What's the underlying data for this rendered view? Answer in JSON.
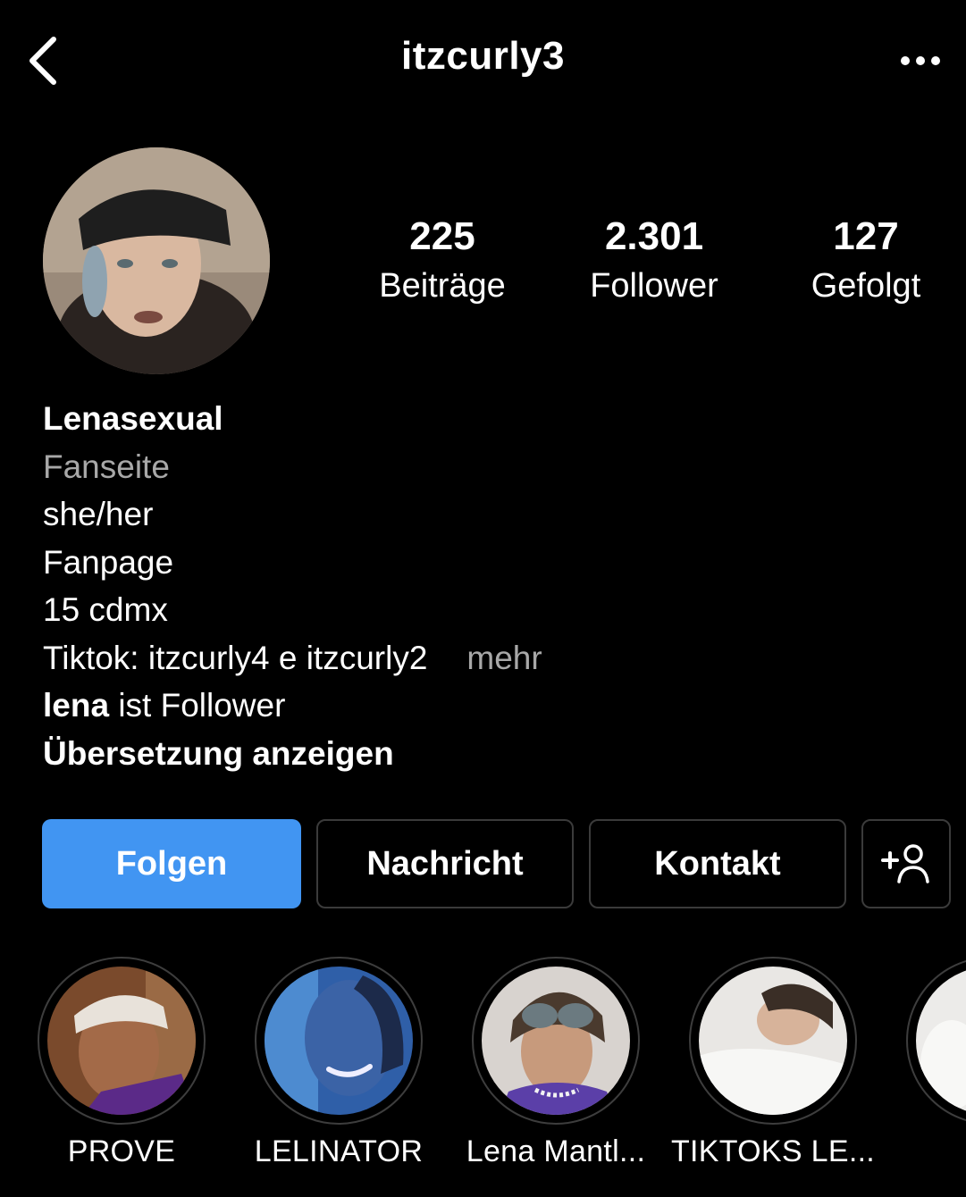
{
  "header": {
    "username": "itzcurly3",
    "back_icon": "chevron-left-icon",
    "more_icon": "ellipsis-icon"
  },
  "stats": [
    {
      "value": "225",
      "label": "Beiträge"
    },
    {
      "value": "2.301",
      "label": "Follower"
    },
    {
      "value": "127",
      "label": "Gefolgt"
    }
  ],
  "bio": {
    "name": "Lenasexual",
    "category": "Fanseite",
    "lines": [
      "she/her",
      "Fanpage",
      "15 cdmx",
      "Tiktok: itzcurly4 e itzcurly2"
    ],
    "more": "mehr",
    "followed_by_name": "lena",
    "followed_by_suffix": " ist Follower",
    "translate": "Übersetzung anzeigen"
  },
  "actions": {
    "follow": "Folgen",
    "message": "Nachricht",
    "contact": "Kontakt",
    "add_user_icon": "add-person-icon"
  },
  "highlights": [
    {
      "label": "PROVE"
    },
    {
      "label": "LELINATOR"
    },
    {
      "label": "Lena Mantl..."
    },
    {
      "label": "TIKTOKS LE..."
    },
    {
      "label": ""
    }
  ],
  "colors": {
    "background": "#000000",
    "primary_button": "#4195f2",
    "muted_text": "#a8a8a8",
    "outline": "#3b3b3b"
  }
}
